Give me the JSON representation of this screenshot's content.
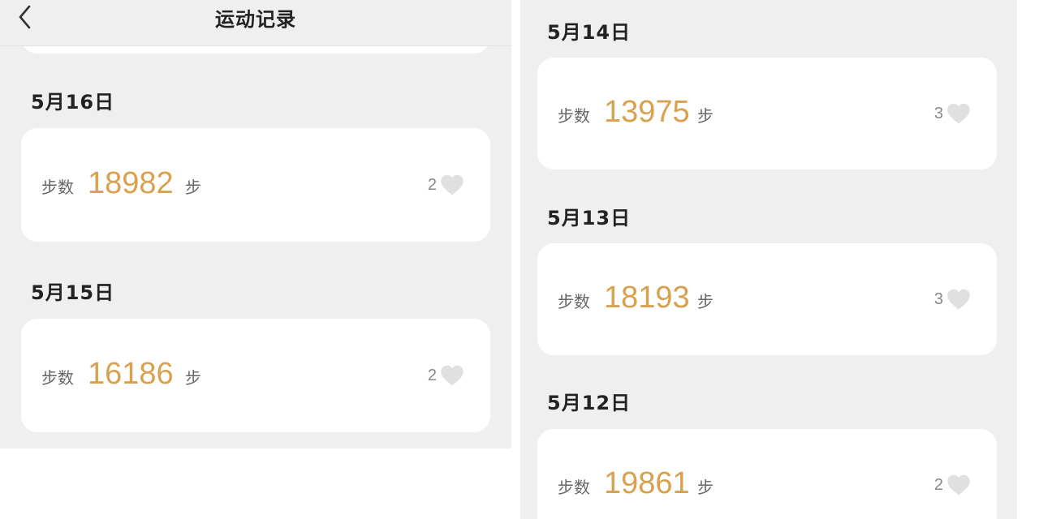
{
  "header": {
    "title": "运动记录",
    "back_icon": "chevron-left-icon"
  },
  "colors": {
    "accent": "#d9a14e",
    "background": "#efefef",
    "card": "#ffffff",
    "heart": "#e0e0e0"
  },
  "left_panel": {
    "records": [
      {
        "date": "5月16日",
        "steps_label": "步数",
        "steps": "18982",
        "unit": "步",
        "likes": "2"
      },
      {
        "date": "5月15日",
        "steps_label": "步数",
        "steps": "16186",
        "unit": "步",
        "likes": "2"
      }
    ]
  },
  "right_panel": {
    "records": [
      {
        "date": "5月14日",
        "steps_label": "步数",
        "steps": "13975",
        "unit": "步",
        "likes": "3"
      },
      {
        "date": "5月13日",
        "steps_label": "步数",
        "steps": "18193",
        "unit": "步",
        "likes": "3"
      },
      {
        "date": "5月12日",
        "steps_label": "步数",
        "steps": "19861",
        "unit": "步",
        "likes": "2"
      }
    ]
  }
}
